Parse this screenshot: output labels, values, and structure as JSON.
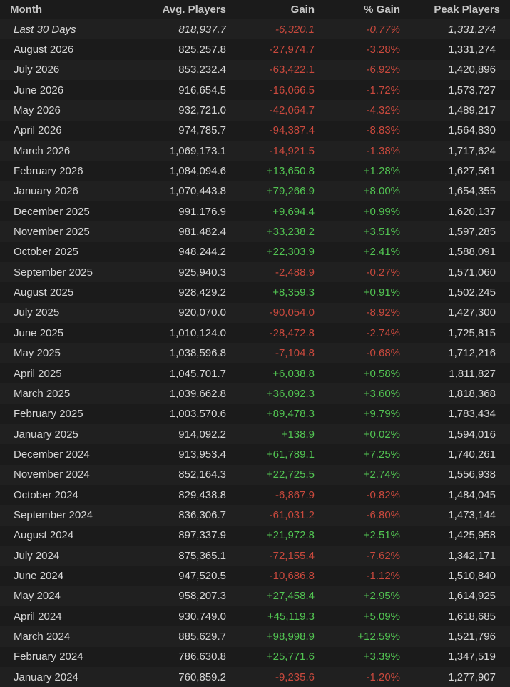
{
  "headers": {
    "month": "Month",
    "avg": "Avg. Players",
    "gain": "Gain",
    "pct": "% Gain",
    "peak": "Peak Players"
  },
  "colors": {
    "negative": "#c9493d",
    "positive": "#52c452",
    "background": "#1b1b1b"
  },
  "rows": [
    {
      "month": "Last 30 Days",
      "avg": "818,937.7",
      "gain": "-6,320.1",
      "pct": "-0.77%",
      "peak": "1,331,274",
      "dir": "neg",
      "summary": true
    },
    {
      "month": "August 2026",
      "avg": "825,257.8",
      "gain": "-27,974.7",
      "pct": "-3.28%",
      "peak": "1,331,274",
      "dir": "neg"
    },
    {
      "month": "July 2026",
      "avg": "853,232.4",
      "gain": "-63,422.1",
      "pct": "-6.92%",
      "peak": "1,420,896",
      "dir": "neg"
    },
    {
      "month": "June 2026",
      "avg": "916,654.5",
      "gain": "-16,066.5",
      "pct": "-1.72%",
      "peak": "1,573,727",
      "dir": "neg"
    },
    {
      "month": "May 2026",
      "avg": "932,721.0",
      "gain": "-42,064.7",
      "pct": "-4.32%",
      "peak": "1,489,217",
      "dir": "neg"
    },
    {
      "month": "April 2026",
      "avg": "974,785.7",
      "gain": "-94,387.4",
      "pct": "-8.83%",
      "peak": "1,564,830",
      "dir": "neg"
    },
    {
      "month": "March 2026",
      "avg": "1,069,173.1",
      "gain": "-14,921.5",
      "pct": "-1.38%",
      "peak": "1,717,624",
      "dir": "neg"
    },
    {
      "month": "February 2026",
      "avg": "1,084,094.6",
      "gain": "+13,650.8",
      "pct": "+1.28%",
      "peak": "1,627,561",
      "dir": "pos"
    },
    {
      "month": "January 2026",
      "avg": "1,070,443.8",
      "gain": "+79,266.9",
      "pct": "+8.00%",
      "peak": "1,654,355",
      "dir": "pos"
    },
    {
      "month": "December 2025",
      "avg": "991,176.9",
      "gain": "+9,694.4",
      "pct": "+0.99%",
      "peak": "1,620,137",
      "dir": "pos"
    },
    {
      "month": "November 2025",
      "avg": "981,482.4",
      "gain": "+33,238.2",
      "pct": "+3.51%",
      "peak": "1,597,285",
      "dir": "pos"
    },
    {
      "month": "October 2025",
      "avg": "948,244.2",
      "gain": "+22,303.9",
      "pct": "+2.41%",
      "peak": "1,588,091",
      "dir": "pos"
    },
    {
      "month": "September 2025",
      "avg": "925,940.3",
      "gain": "-2,488.9",
      "pct": "-0.27%",
      "peak": "1,571,060",
      "dir": "neg"
    },
    {
      "month": "August 2025",
      "avg": "928,429.2",
      "gain": "+8,359.3",
      "pct": "+0.91%",
      "peak": "1,502,245",
      "dir": "pos"
    },
    {
      "month": "July 2025",
      "avg": "920,070.0",
      "gain": "-90,054.0",
      "pct": "-8.92%",
      "peak": "1,427,300",
      "dir": "neg"
    },
    {
      "month": "June 2025",
      "avg": "1,010,124.0",
      "gain": "-28,472.8",
      "pct": "-2.74%",
      "peak": "1,725,815",
      "dir": "neg"
    },
    {
      "month": "May 2025",
      "avg": "1,038,596.8",
      "gain": "-7,104.8",
      "pct": "-0.68%",
      "peak": "1,712,216",
      "dir": "neg"
    },
    {
      "month": "April 2025",
      "avg": "1,045,701.7",
      "gain": "+6,038.8",
      "pct": "+0.58%",
      "peak": "1,811,827",
      "dir": "pos"
    },
    {
      "month": "March 2025",
      "avg": "1,039,662.8",
      "gain": "+36,092.3",
      "pct": "+3.60%",
      "peak": "1,818,368",
      "dir": "pos"
    },
    {
      "month": "February 2025",
      "avg": "1,003,570.6",
      "gain": "+89,478.3",
      "pct": "+9.79%",
      "peak": "1,783,434",
      "dir": "pos"
    },
    {
      "month": "January 2025",
      "avg": "914,092.2",
      "gain": "+138.9",
      "pct": "+0.02%",
      "peak": "1,594,016",
      "dir": "pos"
    },
    {
      "month": "December 2024",
      "avg": "913,953.4",
      "gain": "+61,789.1",
      "pct": "+7.25%",
      "peak": "1,740,261",
      "dir": "pos"
    },
    {
      "month": "November 2024",
      "avg": "852,164.3",
      "gain": "+22,725.5",
      "pct": "+2.74%",
      "peak": "1,556,938",
      "dir": "pos"
    },
    {
      "month": "October 2024",
      "avg": "829,438.8",
      "gain": "-6,867.9",
      "pct": "-0.82%",
      "peak": "1,484,045",
      "dir": "neg"
    },
    {
      "month": "September 2024",
      "avg": "836,306.7",
      "gain": "-61,031.2",
      "pct": "-6.80%",
      "peak": "1,473,144",
      "dir": "neg"
    },
    {
      "month": "August 2024",
      "avg": "897,337.9",
      "gain": "+21,972.8",
      "pct": "+2.51%",
      "peak": "1,425,958",
      "dir": "pos"
    },
    {
      "month": "July 2024",
      "avg": "875,365.1",
      "gain": "-72,155.4",
      "pct": "-7.62%",
      "peak": "1,342,171",
      "dir": "neg"
    },
    {
      "month": "June 2024",
      "avg": "947,520.5",
      "gain": "-10,686.8",
      "pct": "-1.12%",
      "peak": "1,510,840",
      "dir": "neg"
    },
    {
      "month": "May 2024",
      "avg": "958,207.3",
      "gain": "+27,458.4",
      "pct": "+2.95%",
      "peak": "1,614,925",
      "dir": "pos"
    },
    {
      "month": "April 2024",
      "avg": "930,749.0",
      "gain": "+45,119.3",
      "pct": "+5.09%",
      "peak": "1,618,685",
      "dir": "pos"
    },
    {
      "month": "March 2024",
      "avg": "885,629.7",
      "gain": "+98,998.9",
      "pct": "+12.59%",
      "peak": "1,521,796",
      "dir": "pos"
    },
    {
      "month": "February 2024",
      "avg": "786,630.8",
      "gain": "+25,771.6",
      "pct": "+3.39%",
      "peak": "1,347,519",
      "dir": "pos"
    },
    {
      "month": "January 2024",
      "avg": "760,859.2",
      "gain": "-9,235.6",
      "pct": "-1.20%",
      "peak": "1,277,907",
      "dir": "neg"
    }
  ]
}
